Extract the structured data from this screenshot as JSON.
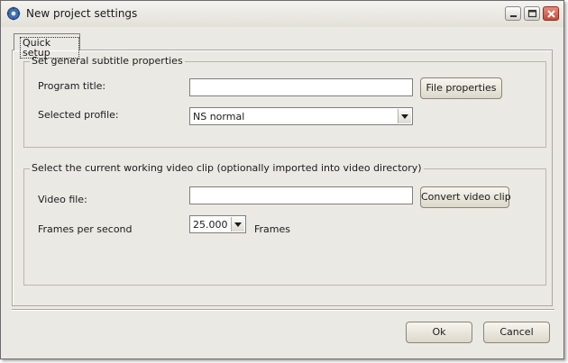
{
  "window": {
    "title": "New project settings",
    "icon": "gear-icon",
    "controls": [
      "minimize-icon",
      "maximize-icon",
      "close-icon"
    ]
  },
  "tabs": [
    {
      "label": "Quick setup",
      "selected": true
    }
  ],
  "general_group": {
    "legend": "Set general subtitle properties",
    "program_title_label": "Program title:",
    "program_title_value": "",
    "file_properties_button": "File properties",
    "selected_profile_label": "Selected profile:",
    "selected_profile_value": "NS normal"
  },
  "video_group": {
    "legend": "Select the current working video clip (optionally imported into video directory)",
    "video_file_label": "Video file:",
    "video_file_value": "",
    "convert_button": "Convert video clip",
    "fps_label": "Frames per second",
    "fps_value": "25.000",
    "fps_unit": "Frames"
  },
  "footer": {
    "ok_label": "Ok",
    "cancel_label": "Cancel"
  },
  "colors": {
    "window_background": "#ebe9e3",
    "close_button": "#c84a36"
  }
}
